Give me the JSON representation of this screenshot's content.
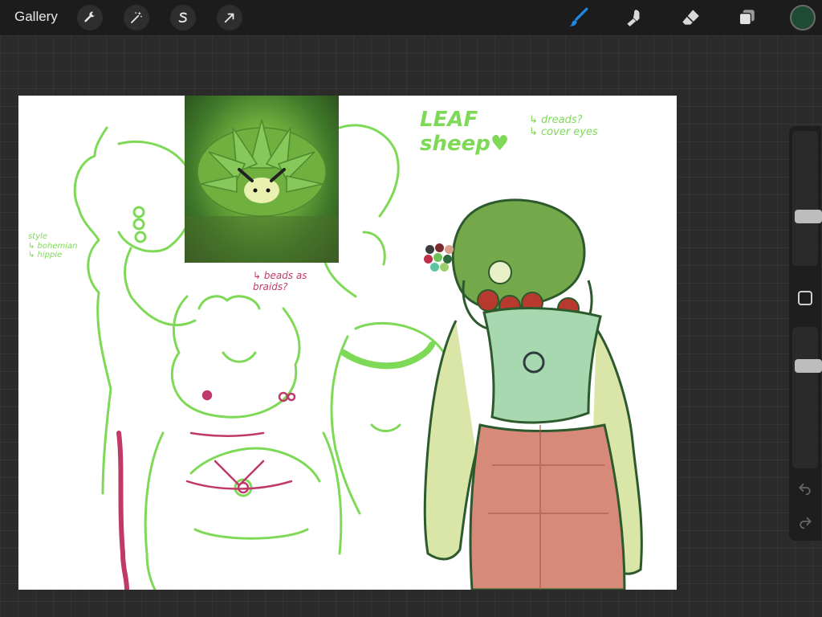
{
  "topbar": {
    "gallery_label": "Gallery",
    "left_tools": [
      "wrench-icon",
      "magic-wand-icon",
      "selection-s-icon",
      "transform-arrow-icon"
    ],
    "right_tools": [
      "brush-icon",
      "smudge-icon",
      "eraser-icon",
      "layers-icon"
    ],
    "active_tool": "brush-icon",
    "current_color": "#1f4a33",
    "active_tool_color": "#1e88e5"
  },
  "canvas": {
    "title_text": "LEAF\nsheep♥",
    "note_top_right": "↳ dreads?\n↳ cover eyes",
    "note_left": "style\n↳ bohemian\n↳ hippie",
    "note_middle": "↳ beads as\nbraids?",
    "palette_colors": [
      "#3b3b3b",
      "#7a2b2b",
      "#d9a090",
      "#c0304a",
      "#6fbf5a",
      "#2e6b3b",
      "#5cc4a0",
      "#9bd06a"
    ],
    "sketch_color": "#7ed957",
    "accent_sketch_color": "#c0396b"
  },
  "sidebar": {
    "brush_size_level": 0.35,
    "opacity_level": 0.75,
    "modify_button": "square-icon",
    "undo": "undo-icon",
    "redo": "redo-icon"
  }
}
